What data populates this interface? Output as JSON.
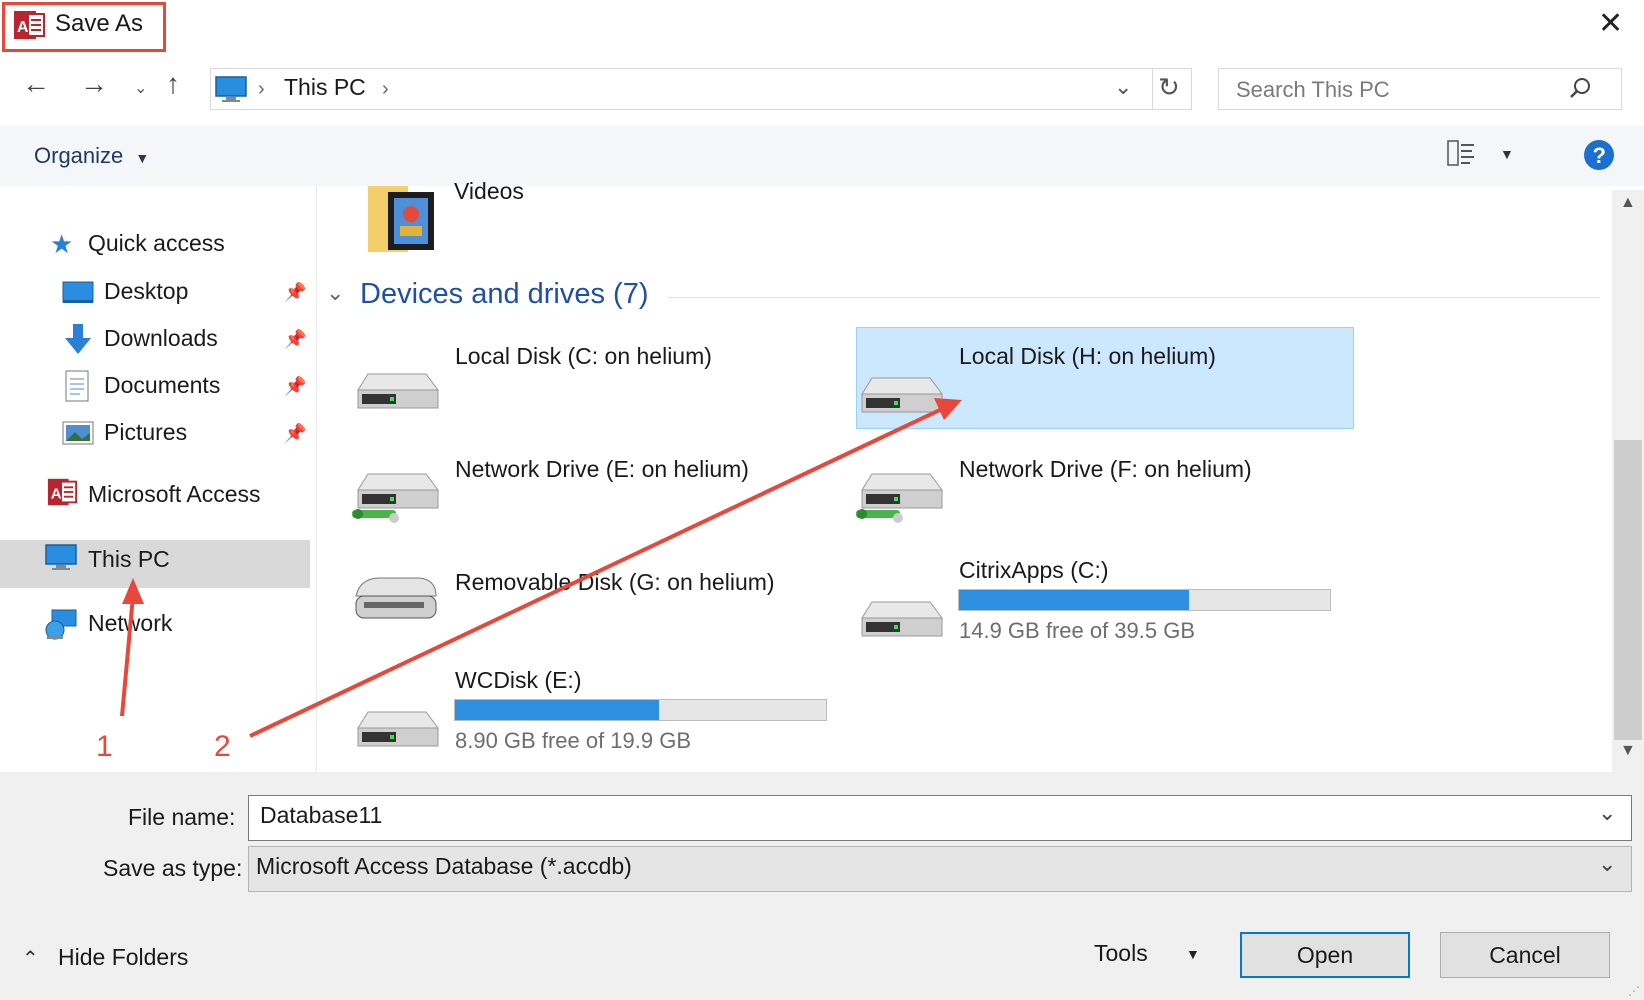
{
  "window": {
    "title": "Save As"
  },
  "address_bar": {
    "location": "This PC"
  },
  "search": {
    "placeholder": "Search This PC"
  },
  "toolbar": {
    "organize_label": "Organize"
  },
  "sidebar": {
    "items": [
      {
        "label": "Quick access"
      },
      {
        "label": "Desktop"
      },
      {
        "label": "Downloads"
      },
      {
        "label": "Documents"
      },
      {
        "label": "Pictures"
      },
      {
        "label": "Microsoft Access"
      },
      {
        "label": "This PC"
      },
      {
        "label": "Network"
      }
    ]
  },
  "content": {
    "folder_label": "Videos",
    "section_title": "Devices and drives (7)",
    "drives": [
      {
        "label": "Local Disk (C: on helium)"
      },
      {
        "label": "Local Disk (H: on helium)"
      },
      {
        "label": "Network Drive (E: on helium)"
      },
      {
        "label": "Network Drive (F: on helium)"
      },
      {
        "label": "Removable Disk (G: on helium)"
      },
      {
        "label": "CitrixApps (C:)",
        "free_text": "14.9 GB free of 39.5 GB",
        "used_fraction": 0.62
      },
      {
        "label": "WCDisk (E:)",
        "free_text": "8.90 GB free of 19.9 GB",
        "used_fraction": 0.55
      }
    ]
  },
  "form": {
    "file_name_label": "File name:",
    "file_name_value": "Database11",
    "save_type_label": "Save as type:",
    "save_type_value": "Microsoft Access Database (*.accdb)"
  },
  "footer": {
    "hide_folders_label": "Hide Folders",
    "tools_label": "Tools",
    "open_label": "Open",
    "cancel_label": "Cancel"
  },
  "annotations": {
    "arrow1": "1",
    "arrow2": "2"
  },
  "colors": {
    "accent": "#0078d7",
    "annotation": "#e8473a",
    "selection": "#cce8ff",
    "progress": "#2e8fe0"
  }
}
